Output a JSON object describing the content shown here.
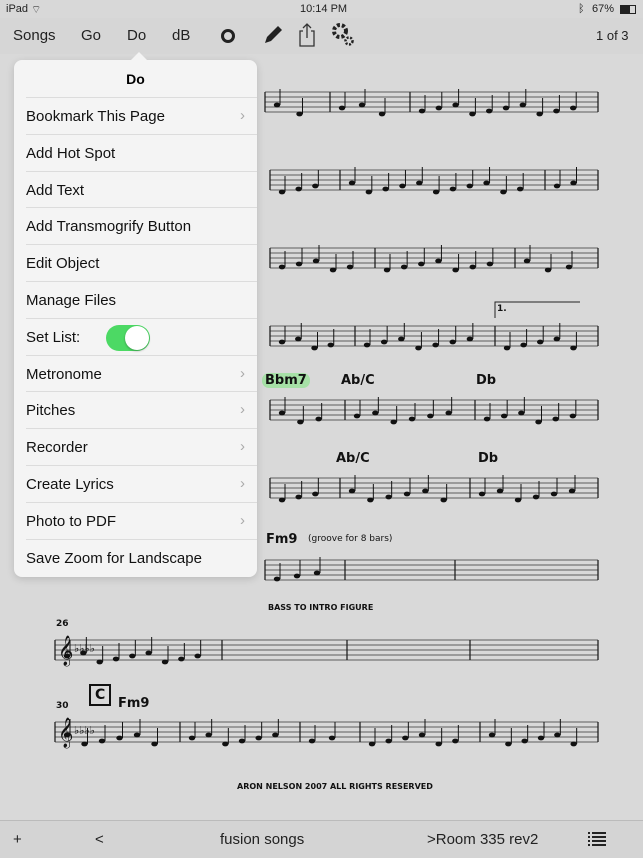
{
  "status": {
    "device": "iPad",
    "time": "10:14 PM",
    "battery": "67%"
  },
  "toolbar": {
    "songs": "Songs",
    "go": "Go",
    "do": "Do",
    "db": "dB",
    "page_indicator": "1 of 3",
    "icons": [
      "record-icon",
      "pencil-icon",
      "share-icon",
      "settings-icon"
    ]
  },
  "menu": {
    "title": "Do",
    "items": [
      {
        "label": "Bookmark This Page",
        "chevron": true
      },
      {
        "label": "Add Hot Spot",
        "chevron": false
      },
      {
        "label": "Add Text",
        "chevron": false
      },
      {
        "label": "Add Transmogrify Button",
        "chevron": false
      },
      {
        "label": "Edit Object",
        "chevron": false
      },
      {
        "label": "Manage Files",
        "chevron": false
      },
      {
        "label": "Set List:",
        "toggle": true,
        "toggle_on": true
      },
      {
        "label": "Metronome",
        "chevron": true
      },
      {
        "label": "Pitches",
        "chevron": true
      },
      {
        "label": "Recorder",
        "chevron": true
      },
      {
        "label": "Create Lyrics",
        "chevron": true
      },
      {
        "label": "Photo to PDF",
        "chevron": true
      },
      {
        "label": "Save Zoom for Landscape",
        "chevron": false
      }
    ]
  },
  "score": {
    "chords": [
      "Bbm7",
      "Ab/C",
      "Db",
      "Ab/C",
      "Db",
      "Fm9",
      "Fm9"
    ],
    "annotation": "(groove for 8 bars)",
    "bass_note": "Bass to intro figure",
    "measure_26": "26",
    "measure_30": "30",
    "rehearsal": "C",
    "copyright": "Aron Nelson 2007 All Rights Reserved",
    "ending": "1."
  },
  "bottom": {
    "add": "+",
    "back": "<",
    "songset": "fusion songs",
    "next": ">Room 335 rev2",
    "list_icon": "list-icon"
  }
}
